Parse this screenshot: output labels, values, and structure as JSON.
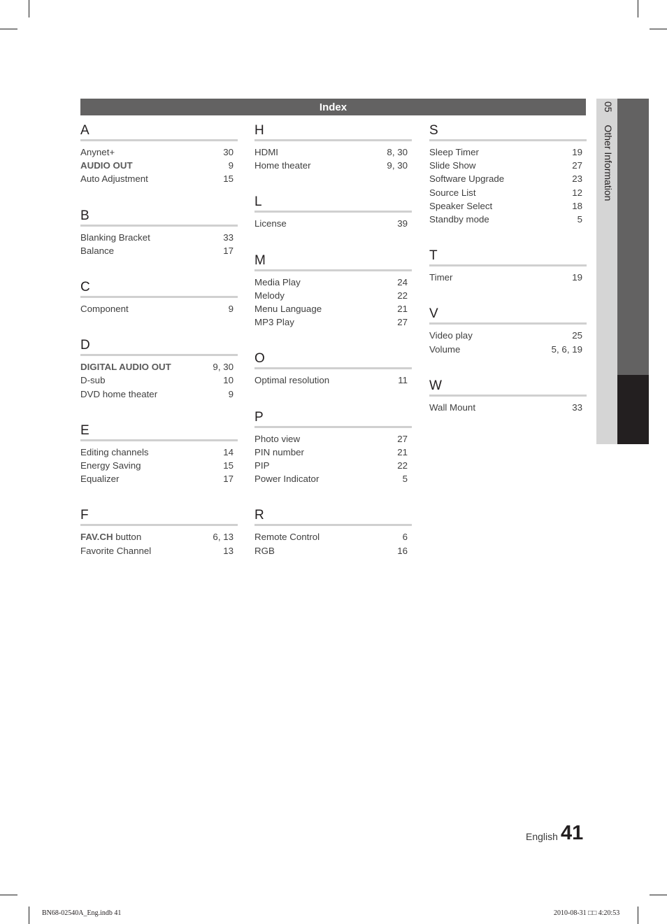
{
  "page": {
    "header_title": "Index",
    "side_tab": {
      "number": "05",
      "label": "Other Information"
    },
    "footer": {
      "language": "English",
      "page_number": "41"
    },
    "print_slug": {
      "left": "BN68-02540A_Eng.indb   41",
      "right": "2010-08-31   □□ 4:20:53"
    },
    "colors": {
      "header_bar": "#636262",
      "side_light": "#d5d5d5",
      "side_dark": "#636262",
      "side_black": "#231f20",
      "rule": "#d0d0d0"
    }
  },
  "columns": [
    {
      "sections": [
        {
          "letter": "A",
          "entries": [
            {
              "term": "Anynet+",
              "pages": "30",
              "bold": ""
            },
            {
              "term": "",
              "bold": "AUDIO OUT",
              "pages": "9"
            },
            {
              "term": "Auto Adjustment",
              "pages": "15",
              "bold": ""
            }
          ]
        },
        {
          "letter": "B",
          "entries": [
            {
              "term": "Blanking Bracket",
              "pages": "33",
              "bold": ""
            },
            {
              "term": "Balance",
              "pages": "17",
              "bold": ""
            }
          ]
        },
        {
          "letter": "C",
          "entries": [
            {
              "term": "Component",
              "pages": "9",
              "bold": ""
            }
          ]
        },
        {
          "letter": "D",
          "entries": [
            {
              "term": "",
              "bold": "DIGITAL AUDIO OUT",
              "pages": "9, 30"
            },
            {
              "term": "D-sub",
              "pages": "10",
              "bold": ""
            },
            {
              "term": "DVD home theater",
              "pages": "9",
              "bold": ""
            }
          ]
        },
        {
          "letter": "E",
          "entries": [
            {
              "term": "Editing channels",
              "pages": "14",
              "bold": ""
            },
            {
              "term": "Energy Saving",
              "pages": "15",
              "bold": ""
            },
            {
              "term": "Equalizer",
              "pages": "17",
              "bold": ""
            }
          ]
        },
        {
          "letter": "F",
          "entries": [
            {
              "term": " button",
              "bold": "FAV.CH",
              "pages": "6, 13"
            },
            {
              "term": "Favorite Channel",
              "pages": "13",
              "bold": ""
            }
          ]
        }
      ]
    },
    {
      "sections": [
        {
          "letter": "H",
          "entries": [
            {
              "term": "HDMI",
              "pages": "8, 30",
              "bold": ""
            },
            {
              "term": "Home theater",
              "pages": "9, 30",
              "bold": ""
            }
          ]
        },
        {
          "letter": "L",
          "entries": [
            {
              "term": "License",
              "pages": "39",
              "bold": ""
            }
          ]
        },
        {
          "letter": "M",
          "entries": [
            {
              "term": "Media Play",
              "pages": "24",
              "bold": ""
            },
            {
              "term": "Melody",
              "pages": "22",
              "bold": ""
            },
            {
              "term": "Menu Language",
              "pages": "21",
              "bold": ""
            },
            {
              "term": "MP3 Play",
              "pages": "27",
              "bold": ""
            }
          ]
        },
        {
          "letter": "O",
          "entries": [
            {
              "term": "Optimal resolution",
              "pages": "11",
              "bold": ""
            }
          ]
        },
        {
          "letter": "P",
          "entries": [
            {
              "term": "Photo view",
              "pages": "27",
              "bold": ""
            },
            {
              "term": "PIN number",
              "pages": "21",
              "bold": ""
            },
            {
              "term": "PIP",
              "pages": "22",
              "bold": ""
            },
            {
              "term": "Power Indicator",
              "pages": "5",
              "bold": ""
            }
          ]
        },
        {
          "letter": "R",
          "entries": [
            {
              "term": "Remote Control",
              "pages": "6",
              "bold": ""
            },
            {
              "term": "RGB",
              "pages": "16",
              "bold": ""
            }
          ]
        }
      ]
    },
    {
      "sections": [
        {
          "letter": "S",
          "entries": [
            {
              "term": "Sleep Timer",
              "pages": "19",
              "bold": ""
            },
            {
              "term": "Slide Show",
              "pages": "27",
              "bold": ""
            },
            {
              "term": "Software Upgrade",
              "pages": "23",
              "bold": ""
            },
            {
              "term": "Source List",
              "pages": "12",
              "bold": ""
            },
            {
              "term": "Speaker Select",
              "pages": "18",
              "bold": ""
            },
            {
              "term": "Standby mode",
              "pages": "5",
              "bold": ""
            }
          ]
        },
        {
          "letter": "T",
          "entries": [
            {
              "term": "Timer",
              "pages": "19",
              "bold": ""
            }
          ]
        },
        {
          "letter": "V",
          "entries": [
            {
              "term": "Video play",
              "pages": "25",
              "bold": ""
            },
            {
              "term": "Volume",
              "pages": "5, 6, 19",
              "bold": ""
            }
          ]
        },
        {
          "letter": "W",
          "entries": [
            {
              "term": "Wall Mount",
              "pages": "33",
              "bold": ""
            }
          ]
        }
      ]
    }
  ]
}
